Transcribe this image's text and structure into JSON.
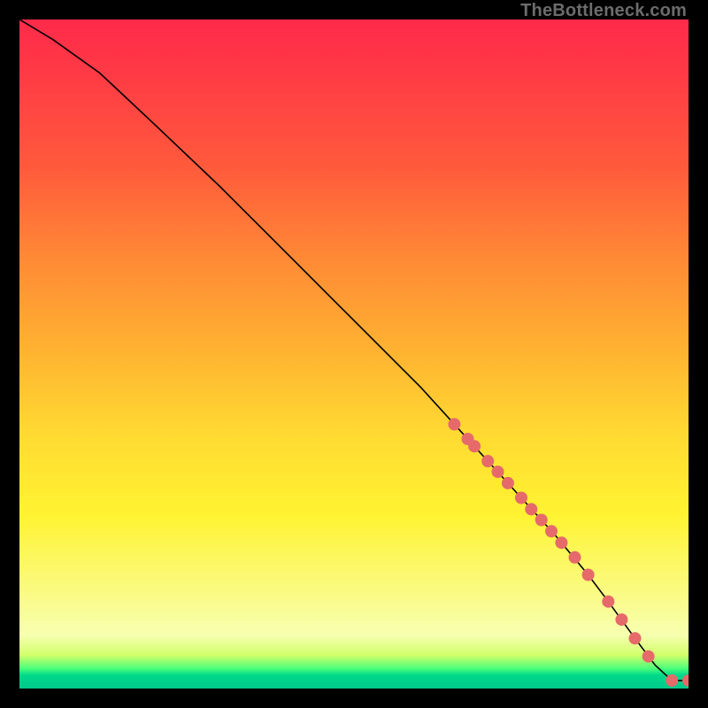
{
  "watermark": "TheBottleneck.com",
  "chart_data": {
    "type": "line",
    "title": "",
    "xlabel": "",
    "ylabel": "",
    "xlim": [
      0,
      100
    ],
    "ylim": [
      0,
      100
    ],
    "notes": "Axis ticks and labels are not rendered in the image; values are normalized 0–100 estimates based on pixel positions.",
    "series": [
      {
        "name": "curve",
        "x": [
          0,
          5,
          12,
          20,
          30,
          40,
          50,
          60,
          65,
          70,
          75,
          80,
          85,
          88,
          92,
          95,
          97.5,
          100
        ],
        "y": [
          100,
          97,
          92,
          84.5,
          75,
          65,
          55,
          45,
          39.5,
          34,
          28.5,
          23,
          17,
          13,
          7.5,
          3.5,
          1.2,
          1.2
        ]
      }
    ],
    "points": [
      {
        "x": 65,
        "y": 39.5
      },
      {
        "x": 67,
        "y": 37.3
      },
      {
        "x": 68,
        "y": 36.2
      },
      {
        "x": 70,
        "y": 34.0
      },
      {
        "x": 71.5,
        "y": 32.4
      },
      {
        "x": 73,
        "y": 30.7
      },
      {
        "x": 75,
        "y": 28.5
      },
      {
        "x": 76.5,
        "y": 26.8
      },
      {
        "x": 78,
        "y": 25.2
      },
      {
        "x": 79.5,
        "y": 23.5
      },
      {
        "x": 81,
        "y": 21.8
      },
      {
        "x": 83,
        "y": 19.6
      },
      {
        "x": 85,
        "y": 17.0
      },
      {
        "x": 88,
        "y": 13.0
      },
      {
        "x": 90,
        "y": 10.3
      },
      {
        "x": 92,
        "y": 7.5
      },
      {
        "x": 94,
        "y": 4.8
      },
      {
        "x": 97.5,
        "y": 1.2
      },
      {
        "x": 100,
        "y": 1.2
      }
    ],
    "gradient_stops": [
      {
        "pos": 0.0,
        "color": "#ff2a4a"
      },
      {
        "pos": 0.22,
        "color": "#ff5a3c"
      },
      {
        "pos": 0.5,
        "color": "#ffb431"
      },
      {
        "pos": 0.74,
        "color": "#fff331"
      },
      {
        "pos": 0.95,
        "color": "#d2ff6a"
      },
      {
        "pos": 1.0,
        "color": "#00c98a"
      }
    ]
  }
}
